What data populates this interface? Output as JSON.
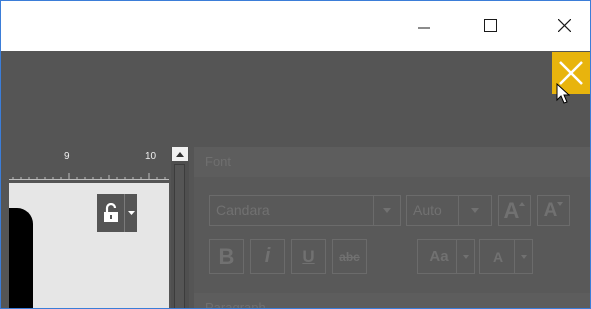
{
  "window": {
    "minimize_icon": "minimize-icon",
    "maximize_icon": "maximize-icon",
    "close_icon": "close-icon"
  },
  "overlay": {
    "close_icon": "close-icon",
    "accent": "#e8b40d"
  },
  "ruler": {
    "labels": [
      "9",
      "10"
    ]
  },
  "canvas": {
    "lock_icon": "unlocked-padlock-icon",
    "dropdown_icon": "chevron-down-icon"
  },
  "font_panel": {
    "title": "Font",
    "font_name": "Candara",
    "font_size": "Auto",
    "grow_label": "A",
    "shrink_label": "A",
    "bold_label": "B",
    "italic_label": "i",
    "underline_label": "U",
    "strike_label": "abc",
    "case_label": "Aa",
    "color_label": "A"
  },
  "paragraph_panel": {
    "title": "Paragraph"
  },
  "colors": {
    "dark_background": "#555555",
    "accent": "#e8b40d",
    "window_border": "#3b7dd8"
  }
}
